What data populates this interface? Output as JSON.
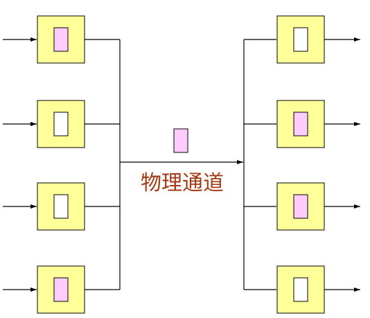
{
  "channel": {
    "label": "物理通道",
    "packet_color": "#ffccff"
  },
  "colors": {
    "frame_fill": "#ffff99",
    "slot_empty": "#ffffff",
    "slot_filled": "#ffccff",
    "line": "#000000",
    "label": "#a23a14"
  },
  "inputs": [
    {
      "id": "in-1",
      "filled": true
    },
    {
      "id": "in-2",
      "filled": false
    },
    {
      "id": "in-3",
      "filled": false
    },
    {
      "id": "in-4",
      "filled": true
    }
  ],
  "outputs": [
    {
      "id": "out-1",
      "filled": false
    },
    {
      "id": "out-2",
      "filled": true
    },
    {
      "id": "out-3",
      "filled": true
    },
    {
      "id": "out-4",
      "filled": false
    }
  ]
}
